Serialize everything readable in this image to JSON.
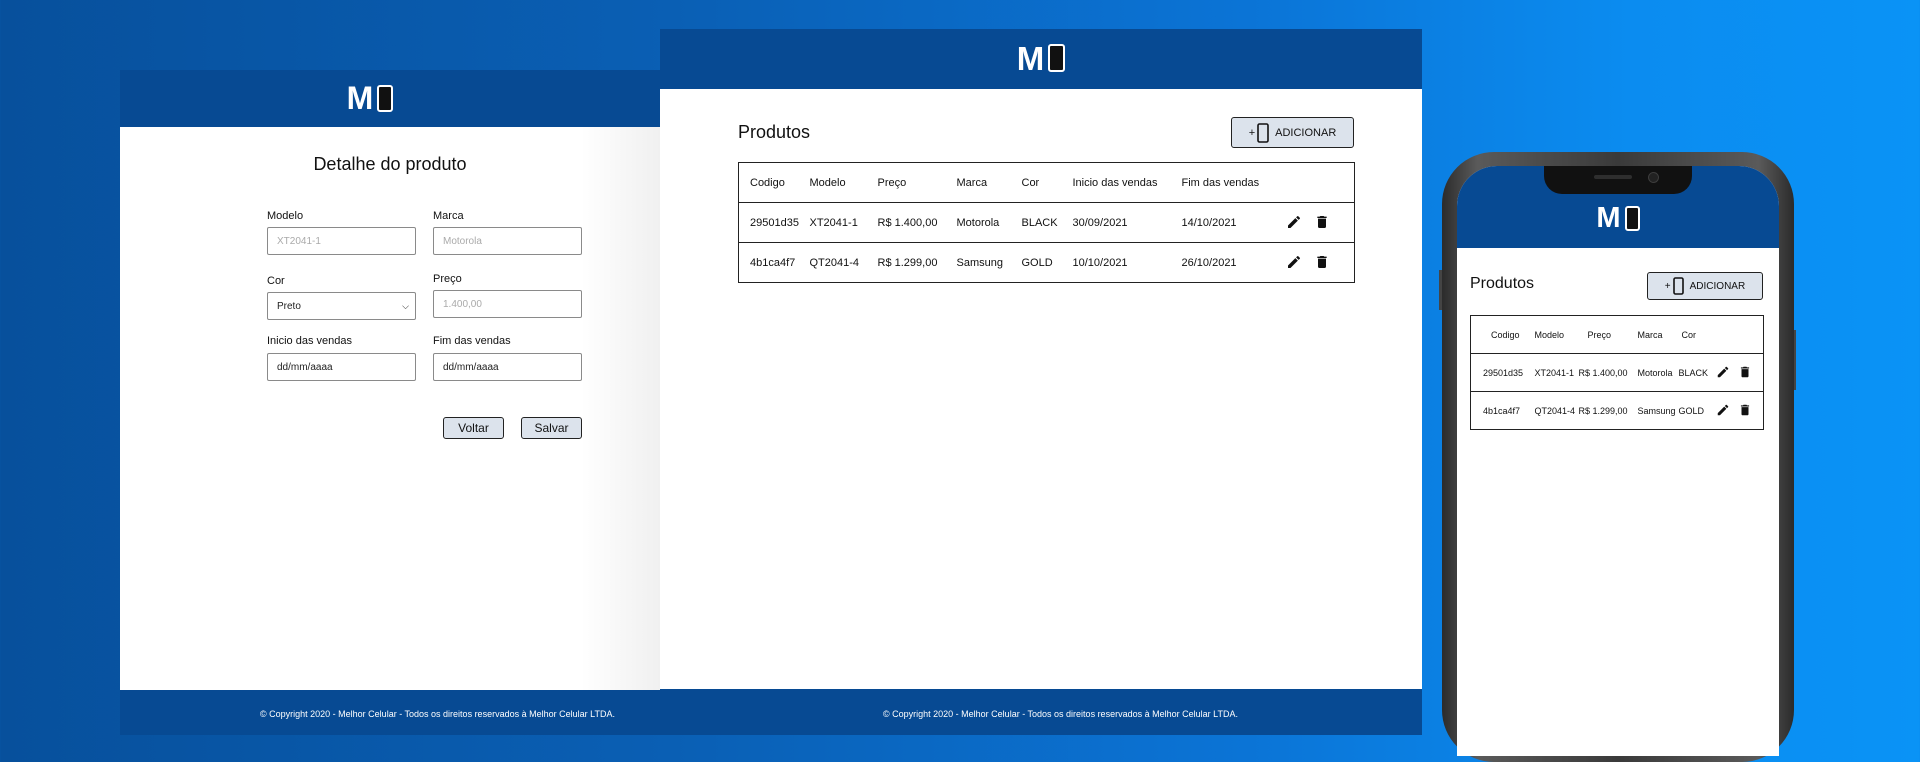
{
  "detail_window": {
    "title": "Detalhe do produto",
    "fields": {
      "modelo": {
        "label": "Modelo",
        "placeholder": "XT2041-1"
      },
      "marca": {
        "label": "Marca",
        "placeholder": "Motorola"
      },
      "cor": {
        "label": "Cor",
        "value": "Preto"
      },
      "preco": {
        "label": "Preço",
        "placeholder": "1.400,00"
      },
      "inicio": {
        "label": "Inicio das vendas",
        "value": "dd/mm/aaaa"
      },
      "fim": {
        "label": "Fim das vendas",
        "value": "dd/mm/aaaa"
      }
    },
    "buttons": {
      "voltar": "Voltar",
      "salvar": "Salvar"
    },
    "footer": "© Copyright 2020 - Melhor Celular - Todos os direitos reservados à Melhor Celular LTDA."
  },
  "products_window": {
    "title": "Produtos",
    "add_plus": "+",
    "add_label": "ADICIONAR",
    "columns": [
      "Codigo",
      "Modelo",
      "Preço",
      "Marca",
      "Cor",
      "Inicio das vendas",
      "Fim das vendas"
    ],
    "rows": [
      [
        "29501d35",
        "XT2041-1",
        "R$ 1.400,00",
        "Motorola",
        "BLACK",
        "30/09/2021",
        "14/10/2021"
      ],
      [
        "4b1ca4f7",
        "QT2041-4",
        "R$ 1.299,00",
        "Samsung",
        "GOLD",
        "10/10/2021",
        "26/10/2021"
      ]
    ],
    "footer": "© Copyright 2020 - Melhor Celular - Todos os direitos reservados à Melhor Celular LTDA."
  },
  "phone": {
    "title": "Produtos",
    "add_plus": "+",
    "add_label": "ADICIONAR",
    "columns": [
      "Codigo",
      "Modelo",
      "Preço",
      "Marca",
      "Cor"
    ],
    "rows": [
      [
        "29501d35",
        "XT2041-1",
        "R$ 1.400,00",
        "Motorola",
        "BLACK"
      ],
      [
        "4b1ca4f7",
        "QT2041-4",
        "R$ 1.299,00",
        "Samsung",
        "GOLD"
      ]
    ]
  },
  "logo_letter": "M",
  "colors": {
    "brand": "#074a93",
    "button_bg": "#dce3ec"
  },
  "icons": [
    "phone-icon",
    "edit-icon",
    "trash-icon",
    "chevron-down-icon"
  ]
}
